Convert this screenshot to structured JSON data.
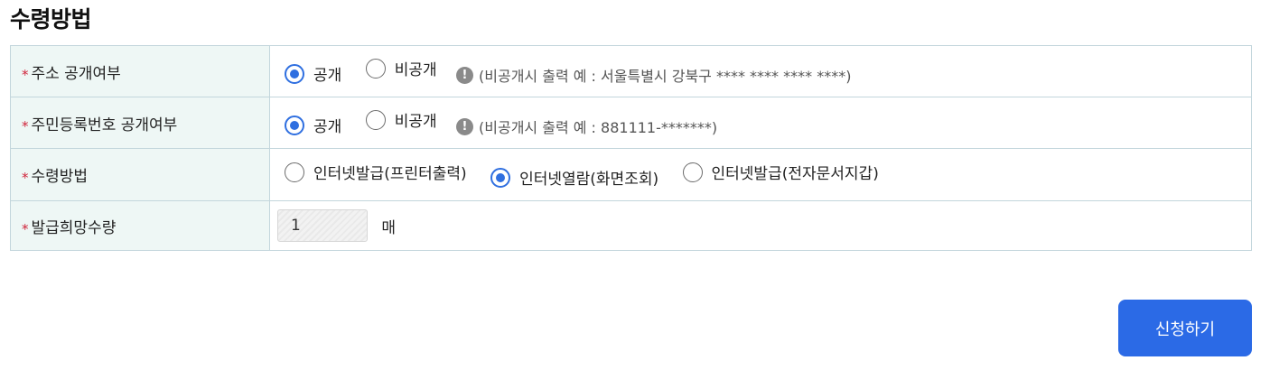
{
  "section_title": "수령방법",
  "required_mark": "*",
  "rows": {
    "address": {
      "label": "주소 공개여부",
      "options": [
        {
          "label": "공개",
          "checked": true
        },
        {
          "label": "비공개",
          "checked": false
        }
      ],
      "note": "(비공개시 출력 예 : 서울특별시 강북구 **** **** **** ****)"
    },
    "resident": {
      "label": "주민등록번호 공개여부",
      "options": [
        {
          "label": "공개",
          "checked": true
        },
        {
          "label": "비공개",
          "checked": false
        }
      ],
      "note": "(비공개시 출력 예 : 881111-*******)"
    },
    "method": {
      "label": "수령방법",
      "options": [
        {
          "label": "인터넷발급(프린터출력)",
          "checked": false
        },
        {
          "label": "인터넷열람(화면조회)",
          "checked": true
        },
        {
          "label": "인터넷발급(전자문서지갑)",
          "checked": false
        }
      ]
    },
    "quantity": {
      "label": "발급희망수량",
      "value": "1",
      "unit": "매"
    }
  },
  "info_icon_glyph": "!",
  "submit_label": "신청하기",
  "colors": {
    "accent": "#2b6ae6",
    "radio_checked": "#2f6fe0",
    "label_bg": "#eef7f5",
    "border": "#c3d6dc",
    "required": "#d0243b"
  },
  "icons": [
    "info-icon",
    "radio-icon"
  ]
}
